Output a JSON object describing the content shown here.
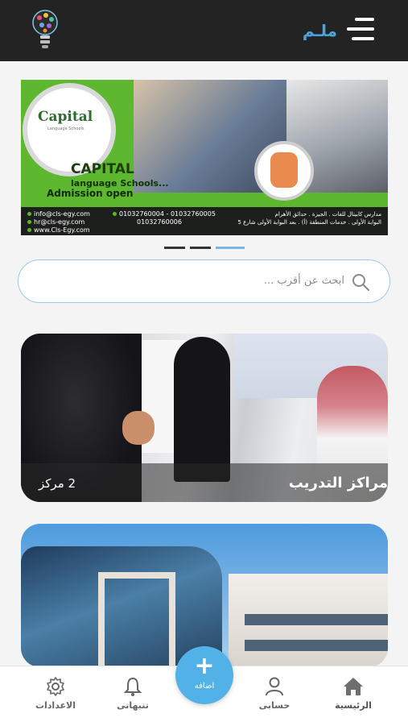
{
  "header": {
    "app_name": "ملـم",
    "menu_icon": "hamburger-menu-icon",
    "logo_icon": "lightbulb-logo-icon",
    "background": "#232323",
    "accent": "#4aa3dc"
  },
  "banner": {
    "logo_text": "Capital",
    "logo_subtext": "Language Schools",
    "title": "CAPITAL",
    "subtitle": "language Schools...",
    "admission": "Admission open",
    "contacts": {
      "emails": [
        "info@cls-egy.com",
        "hr@cls-egy.com",
        "www.Cls-Egy.com"
      ],
      "phones": [
        "01032760004 - 01032760005",
        "01032760006"
      ],
      "address": [
        "مدارس كابيتال للغات . الجيزة . حدائق الأهرام",
        "البوابة الأولى . خدمات المنطقة (أ) . بعد البوابة الأولى شارع 5"
      ]
    },
    "slides_total": 3,
    "active_slide": 3
  },
  "search": {
    "placeholder": "ابحث عن أقرب ...",
    "icon": "search-icon"
  },
  "categories": [
    {
      "title": "مراكز التدريب",
      "count": "2 مركز"
    },
    {
      "title": "",
      "count": ""
    }
  ],
  "bottom_nav": {
    "items": [
      {
        "label": "الرئيسية",
        "icon": "home-icon",
        "active": true
      },
      {
        "label": "حسابى",
        "icon": "user-icon",
        "active": false
      },
      {
        "label": "تنبهاتى",
        "icon": "bell-icon",
        "active": false
      },
      {
        "label": "الاعدادات",
        "icon": "gear-icon",
        "active": false
      }
    ],
    "fab": {
      "label": "اضافه",
      "icon": "plus-icon",
      "color": "#52b1e6"
    }
  }
}
